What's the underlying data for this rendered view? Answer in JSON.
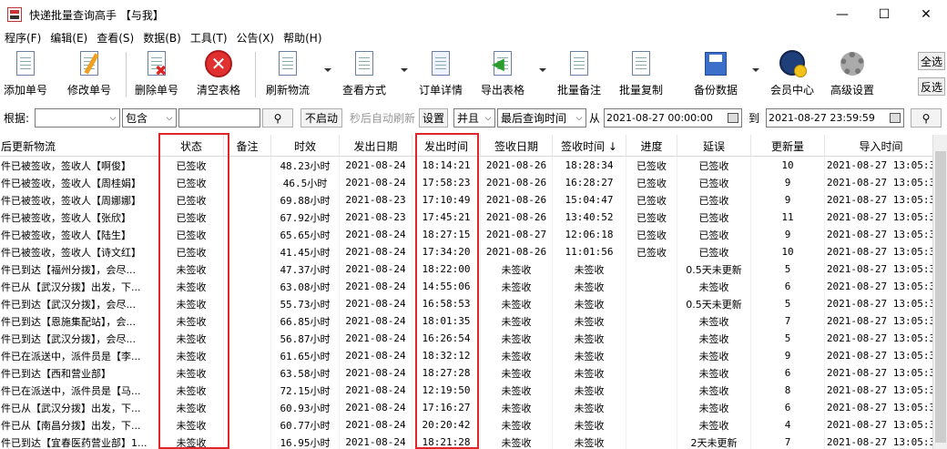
{
  "window": {
    "title": "快递批量查询高手 【与我】",
    "min_glyph": "—",
    "max_glyph": "☐",
    "close_glyph": "✕"
  },
  "menu": [
    "程序(F)",
    "编辑(E)",
    "查看(S)",
    "数据(B)",
    "工具(T)",
    "公告(X)",
    "帮助(H)"
  ],
  "toolbar": {
    "add": "添加单号",
    "edit": "修改单号",
    "delete": "删除单号",
    "clear": "清空表格",
    "refresh": "刷新物流",
    "view_mode": "查看方式",
    "order_detail": "订单详情",
    "export": "导出表格",
    "batch_note": "批量备注",
    "batch_copy": "批量复制",
    "backup": "备份数据",
    "member": "会员中心",
    "advanced": "高级设置",
    "select_all": "全选",
    "invert": "反选"
  },
  "filter": {
    "by_label": "根据:",
    "field_value": "",
    "match_value": "包含",
    "search_value": "",
    "auto_btn": "不启动",
    "auto_refresh_text": "秒后自动刷新",
    "settings_btn": "设置",
    "logic_value": "并且",
    "time_field_value": "最后查询时间",
    "from_label": "从",
    "from_value": "2021-08-27 00:00:00",
    "to_label": "到",
    "to_value": "2021-08-27 23:59:59"
  },
  "columns": [
    "后更新物流",
    "状态",
    "备注",
    "时效",
    "发出日期",
    "发出时间",
    "签收日期",
    "签收时间 ↓",
    "进度",
    "延误",
    "更新量",
    "导入时间"
  ],
  "rows": [
    [
      "件已被签收，签收人【啊俊】",
      "已签收",
      "",
      "48.23小时",
      "2021-08-24",
      "18:14:21",
      "2021-08-26",
      "18:28:34",
      "已签收",
      "已签收",
      "10",
      "2021-08-27 13:05:3"
    ],
    [
      "件已被签收，签收人【周桂娟】",
      "已签收",
      "",
      "46.5小时",
      "2021-08-24",
      "17:58:23",
      "2021-08-26",
      "16:28:27",
      "已签收",
      "已签收",
      "9",
      "2021-08-27 13:05:3"
    ],
    [
      "件已被签收，签收人【周娜娜】",
      "已签收",
      "",
      "69.88小时",
      "2021-08-23",
      "17:10:49",
      "2021-08-26",
      "15:04:47",
      "已签收",
      "已签收",
      "9",
      "2021-08-27 13:05:3"
    ],
    [
      "件已被签收，签收人【张欣】",
      "已签收",
      "",
      "67.92小时",
      "2021-08-23",
      "17:45:21",
      "2021-08-26",
      "13:40:52",
      "已签收",
      "已签收",
      "11",
      "2021-08-27 13:05:3"
    ],
    [
      "件已被签收，签收人【陆生】",
      "已签收",
      "",
      "65.65小时",
      "2021-08-24",
      "18:27:15",
      "2021-08-27",
      "12:06:18",
      "已签收",
      "已签收",
      "9",
      "2021-08-27 13:05:3"
    ],
    [
      "件已被签收，签收人【诗文红】",
      "已签收",
      "",
      "41.45小时",
      "2021-08-24",
      "17:34:20",
      "2021-08-26",
      "11:01:56",
      "已签收",
      "已签收",
      "10",
      "2021-08-27 13:05:3"
    ],
    [
      "件已到达【福州分拨】，会尽...",
      "未签收",
      "",
      "47.37小时",
      "2021-08-24",
      "18:22:00",
      "未签收",
      "未签收",
      "",
      "0.5天未更新",
      "5",
      "2021-08-27 13:05:3"
    ],
    [
      "件已从【武汉分拨】出发，下...",
      "未签收",
      "",
      "63.08小时",
      "2021-08-24",
      "14:55:06",
      "未签收",
      "未签收",
      "",
      "未签收",
      "6",
      "2021-08-27 13:05:3"
    ],
    [
      "件已到达【武汉分拨】，会尽...",
      "未签收",
      "",
      "55.73小时",
      "2021-08-24",
      "16:58:53",
      "未签收",
      "未签收",
      "",
      "0.5天未更新",
      "5",
      "2021-08-27 13:05:3"
    ],
    [
      "件已到达【恩施集配站】，会...",
      "未签收",
      "",
      "66.85小时",
      "2021-08-24",
      "18:01:35",
      "未签收",
      "未签收",
      "",
      "未签收",
      "7",
      "2021-08-27 13:05:3"
    ],
    [
      "件已到达【武汉分拨】，会尽...",
      "未签收",
      "",
      "56.87小时",
      "2021-08-24",
      "16:26:54",
      "未签收",
      "未签收",
      "",
      "未签收",
      "5",
      "2021-08-27 13:05:3"
    ],
    [
      "件已在派送中，派件员是【李...",
      "未签收",
      "",
      "61.65小时",
      "2021-08-24",
      "18:32:12",
      "未签收",
      "未签收",
      "",
      "未签收",
      "9",
      "2021-08-27 13:05:3"
    ],
    [
      "件已到达【西和营业部】",
      "未签收",
      "",
      "63.58小时",
      "2021-08-24",
      "18:27:28",
      "未签收",
      "未签收",
      "",
      "未签收",
      "6",
      "2021-08-27 13:05:3"
    ],
    [
      "件已在派送中，派件员是【马...",
      "未签收",
      "",
      "72.15小时",
      "2021-08-24",
      "12:19:50",
      "未签收",
      "未签收",
      "",
      "未签收",
      "8",
      "2021-08-27 13:05:3"
    ],
    [
      "件已从【武汉分拨】出发，下...",
      "未签收",
      "",
      "60.93小时",
      "2021-08-24",
      "17:16:27",
      "未签收",
      "未签收",
      "",
      "未签收",
      "6",
      "2021-08-27 13:05:3"
    ],
    [
      "件已从【南昌分拨】出发，下...",
      "未签收",
      "",
      "60.77小时",
      "2021-08-24",
      "20:20:42",
      "未签收",
      "未签收",
      "",
      "未签收",
      "4",
      "2021-08-27 13:05:3"
    ],
    [
      "件已到达【宜春医药营业部】1...",
      "未签收",
      "",
      "16.95小时",
      "2021-08-24",
      "18:21:28",
      "未签收",
      "未签收",
      "",
      "2天未更新",
      "7",
      "2021-08-27 13:05:3"
    ]
  ],
  "colors": {
    "highlight": "#e0262a",
    "grid_line": "#e5e5e5"
  }
}
